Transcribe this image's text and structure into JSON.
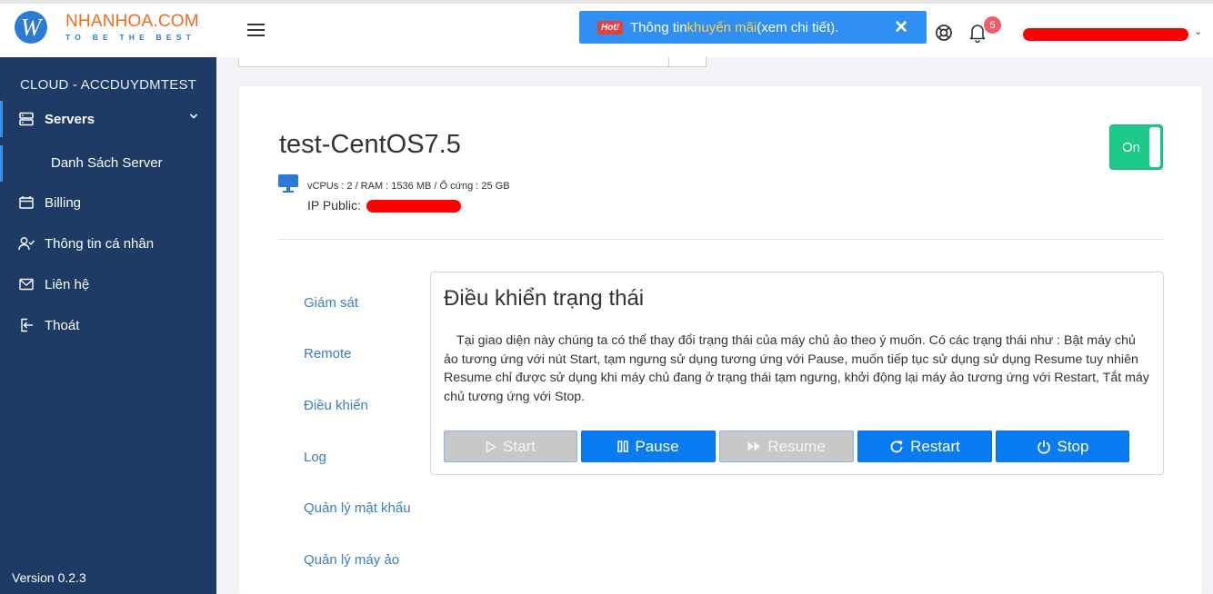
{
  "header": {
    "logo_letter": "W",
    "logo_title": "NHANHOA.COM",
    "logo_tagline": "TO BE THE BEST",
    "promo": {
      "hot_label": "Hot!",
      "text_before": "Thông tin ",
      "text_highlight": "khuyến mãi",
      "text_after": " (xem chi tiết).",
      "close_glyph": "✕"
    },
    "notification_count": "5",
    "user_caret": "⌄"
  },
  "sidebar": {
    "account": "CLOUD - ACCDUYDMTEST",
    "items": [
      {
        "label": "Servers",
        "icon": "server-icon"
      },
      {
        "label": "Billing",
        "icon": "billing-icon"
      },
      {
        "label": "Thông tin cá nhân",
        "icon": "user-icon"
      },
      {
        "label": "Liên hệ",
        "icon": "mail-icon"
      },
      {
        "label": "Thoát",
        "icon": "logout-icon"
      }
    ],
    "subitem": "Danh Sách Server",
    "version": "Version 0.2.3"
  },
  "vm": {
    "name": "test-CentOS7.5",
    "power_label": "On",
    "specs": "vCPUs : 2 / RAM : 1536 MB / Ổ cứng : 25 GB",
    "ip_label": "IP Public:"
  },
  "tabs": [
    "Giám sát",
    "Remote",
    "Điều khiển",
    "Log",
    "Quản lý mật khẩu",
    "Quản lý máy ảo"
  ],
  "panel": {
    "title": "Điều khiển trạng thái",
    "description": "Tại giao diện này chúng ta có thể thay đổi trạng thái của máy chủ ảo theo ý muốn. Có các trạng thái như : Bật máy chủ ảo tương ứng với nút Start, tạm ngưng sử dụng tương ứng với Pause, muốn tiếp tục sử dụng sử dụng Resume tuy nhiên Resume chỉ được sử dụng khi máy chủ đang ở trạng thái tạm ngưng, khởi động lại máy ảo tương ứng với Restart, Tắt máy chủ tương ứng với Stop.",
    "buttons": [
      {
        "label": "Start",
        "icon": "play-icon",
        "enabled": false
      },
      {
        "label": "Pause",
        "icon": "pause-icon",
        "enabled": true
      },
      {
        "label": "Resume",
        "icon": "fast-forward-icon",
        "enabled": false
      },
      {
        "label": "Restart",
        "icon": "refresh-icon",
        "enabled": true
      },
      {
        "label": "Stop",
        "icon": "power-icon",
        "enabled": true
      }
    ]
  },
  "colors": {
    "sidebar_bg": "#1e3b66",
    "accent": "#0a7cf2",
    "power_on": "#1cc98a",
    "promo_bg": "#2f8ff2",
    "redaction": "#ff0000"
  }
}
